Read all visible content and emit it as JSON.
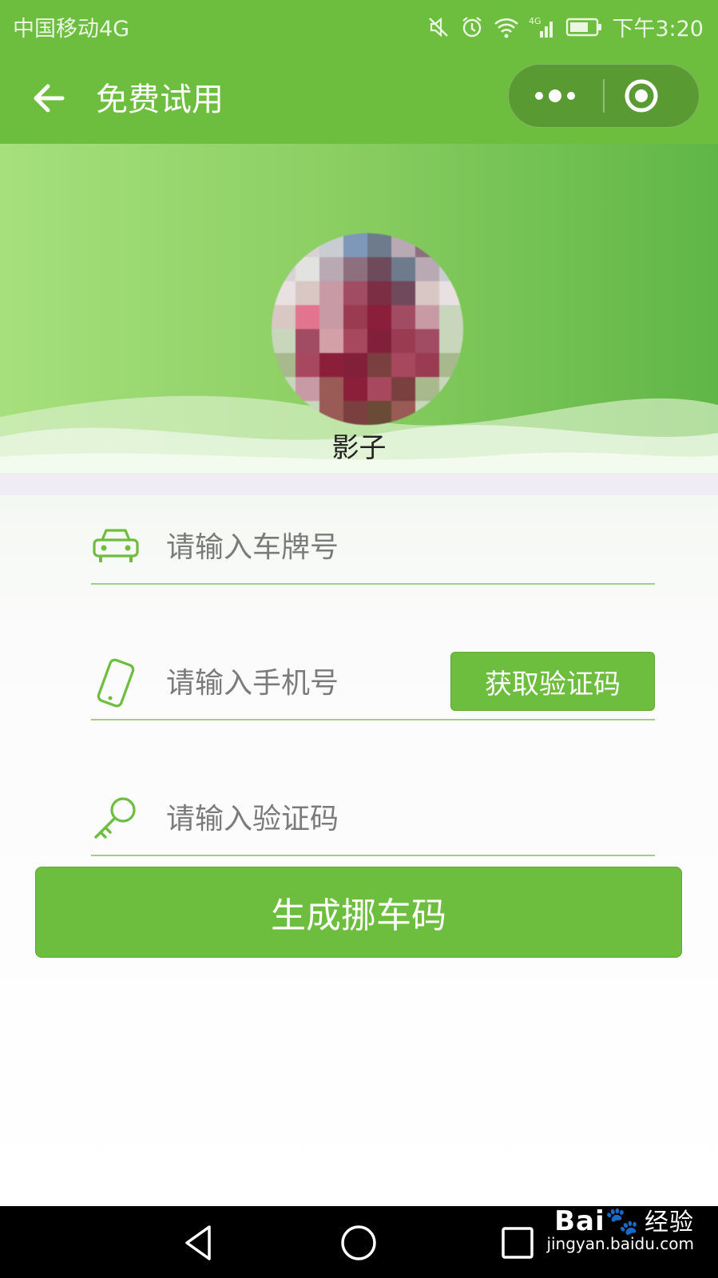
{
  "status_bar": {
    "carrier": "中国移动4G",
    "time": "下午3:20",
    "network": "4G"
  },
  "nav": {
    "title": "免费试用"
  },
  "profile": {
    "username": "影子"
  },
  "form": {
    "plate_placeholder": "请输入车牌号",
    "phone_placeholder": "请输入手机号",
    "get_code_label": "获取验证码",
    "code_placeholder": "请输入验证码",
    "submit_label": "生成挪车码"
  },
  "watermark": {
    "brand": "Bai",
    "brand_cn": "经验",
    "url": "jingyan.baidu.com"
  },
  "colors": {
    "accent": "#6dbd3f",
    "accent_dark": "#5a9a33",
    "underline": "#9fd082"
  },
  "icons": {
    "back": "back-arrow-icon",
    "more": "more-dots-icon",
    "close": "target-close-icon",
    "car": "car-icon",
    "phone": "phone-icon",
    "key": "key-icon"
  }
}
